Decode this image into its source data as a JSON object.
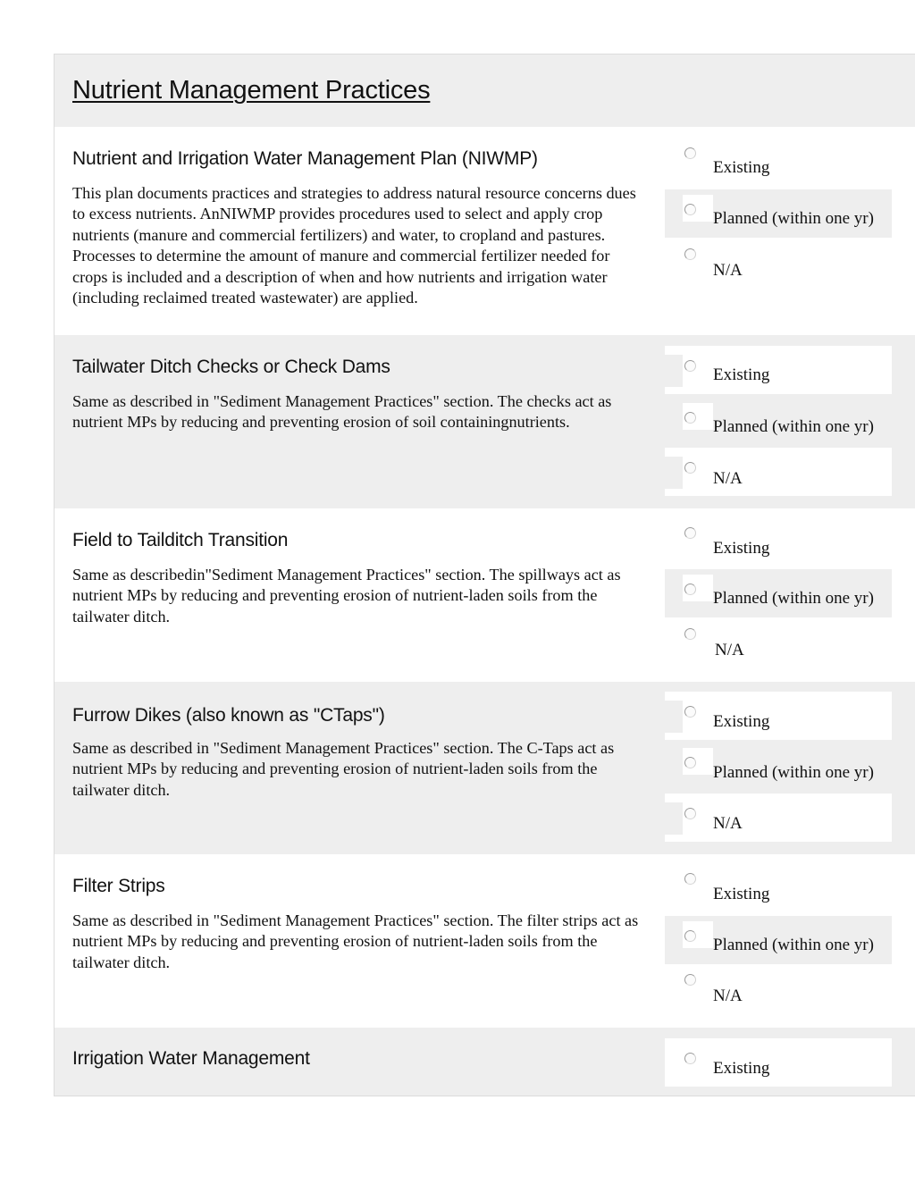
{
  "section": {
    "title": "Nutrient Management Practices"
  },
  "practices": [
    {
      "title": "Nutrient and Irrigation Water Management Plan (NIWMP)",
      "description": "This plan documents practices and strategies to address natural resource concerns dues to excess nutrients. AnNIWMP provides procedures used to select and apply crop nutrients (manure and commercial fertilizers) and water, to cropland and pastures. Processes to determine the amount of manure and commercial fertilizer needed for crops is included and a description of when and how nutrients and irrigation water (including reclaimed treated wastewater) are applied.",
      "options": [
        "Existing",
        "Planned (within one yr)",
        "N/A"
      ],
      "selected": null
    },
    {
      "title": "Tailwater Ditch Checks or Check Dams",
      "description": "Same as described in \"Sediment Management Practices\" section. The checks act as nutrient MPs by reducing and preventing erosion of soil containingnutrients.",
      "options": [
        "Existing",
        "Planned (within one yr)",
        "N/A"
      ],
      "selected": null
    },
    {
      "title": "Field to Tailditch Transition",
      "description": "Same as describedin\"Sediment Management Practices\" section. The spillways act as nutrient MPs by reducing and preventing erosion of nutrient-laden soils from the tailwater ditch.",
      "options": [
        "Existing",
        "Planned (within one yr)",
        "N/A"
      ],
      "selected": null
    },
    {
      "title": "Furrow Dikes (also known as \"CTaps\")",
      "description": "Same as described in \"Sediment Management Practices\" section. The C-Taps act as nutrient MPs by reducing and preventing erosion of nutrient-laden soils from the tailwater ditch.",
      "options": [
        "Existing",
        "Planned (within one yr)",
        "N/A"
      ],
      "selected": null
    },
    {
      "title": "Filter Strips",
      "description": "Same as described in \"Sediment Management Practices\" section. The filter strips act as nutrient MPs by reducing and preventing erosion of nutrient-laden soils from the tailwater ditch.",
      "options": [
        "Existing",
        "Planned (within one yr)",
        "N/A"
      ],
      "selected": null
    },
    {
      "title": "Irrigation Water Management",
      "description": "",
      "options": [
        "Existing"
      ],
      "selected": null
    }
  ]
}
